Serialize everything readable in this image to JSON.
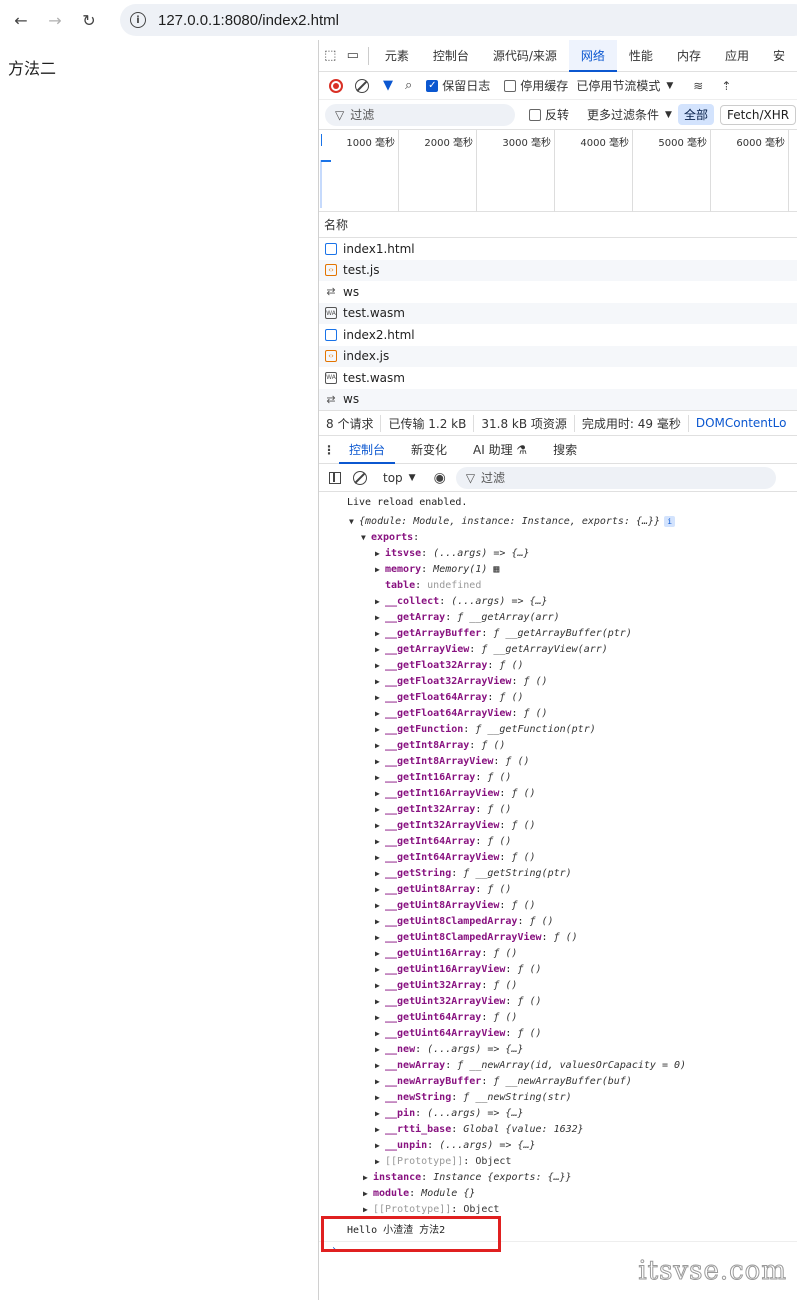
{
  "browser": {
    "url": "127.0.0.1:8080/index2.html"
  },
  "page": {
    "heading": "方法二"
  },
  "devtools": {
    "tabs": [
      "元素",
      "控制台",
      "源代码/来源",
      "网络",
      "性能",
      "内存",
      "应用",
      "安"
    ],
    "active_tab": "网络",
    "network_toolbar": {
      "preserve_log": "保留日志",
      "disable_cache": "停用缓存",
      "throttle": "已停用节流模式"
    },
    "filter_row": {
      "placeholder": "过滤",
      "invert": "反转",
      "more_filters": "更多过滤条件",
      "all": "全部",
      "fetch_xhr": "Fetch/XHR"
    },
    "timeline_ticks": [
      "1000 毫秒",
      "2000 毫秒",
      "3000 毫秒",
      "4000 毫秒",
      "5000 毫秒",
      "6000 毫秒"
    ],
    "requests_header": "名称",
    "requests": [
      {
        "name": "index1.html",
        "icon": "document-icon"
      },
      {
        "name": "test.js",
        "icon": "script-icon"
      },
      {
        "name": "ws",
        "icon": "websocket-icon"
      },
      {
        "name": "test.wasm",
        "icon": "wasm-icon"
      },
      {
        "name": "index2.html",
        "icon": "document-icon"
      },
      {
        "name": "index.js",
        "icon": "script-icon"
      },
      {
        "name": "test.wasm",
        "icon": "wasm-icon"
      },
      {
        "name": "ws",
        "icon": "websocket-icon"
      }
    ],
    "summary": {
      "requests": "8 个请求",
      "transferred": "已传输 1.2 kB",
      "resources": "31.8 kB 项资源",
      "finish": "完成用时: 49 毫秒",
      "dcl": "DOMContentLo"
    },
    "drawer_tabs": [
      "控制台",
      "新变化",
      "AI 助理 ⚗",
      "搜索"
    ],
    "console_toolbar": {
      "context": "top",
      "filter_placeholder": "过滤"
    },
    "console": {
      "live_reload": "Live reload enabled.",
      "object_summary_module": "module",
      "object_summary": {
        "module_key": "module",
        "module_val": "Module",
        "instance_key": "instance",
        "instance_val": "Instance",
        "exports_key": "exports",
        "exports_val": "{…}"
      },
      "exports_label": "exports",
      "exports": [
        {
          "key": "itsvse",
          "val": "(...args) => {…}",
          "expand": true
        },
        {
          "key": "memory",
          "val": "Memory(1) ▦",
          "expand": true
        },
        {
          "key": "table",
          "val": "undefined",
          "expand": false,
          "muted": true
        },
        {
          "key": "__collect",
          "val": "(...args) => {…}",
          "expand": true
        },
        {
          "key": "__getArray",
          "val": "ƒ __getArray(arr)",
          "expand": true
        },
        {
          "key": "__getArrayBuffer",
          "val": "ƒ __getArrayBuffer(ptr)",
          "expand": true
        },
        {
          "key": "__getArrayView",
          "val": "ƒ __getArrayView(arr)",
          "expand": true
        },
        {
          "key": "__getFloat32Array",
          "val": "ƒ ()",
          "expand": true
        },
        {
          "key": "__getFloat32ArrayView",
          "val": "ƒ ()",
          "expand": true
        },
        {
          "key": "__getFloat64Array",
          "val": "ƒ ()",
          "expand": true
        },
        {
          "key": "__getFloat64ArrayView",
          "val": "ƒ ()",
          "expand": true
        },
        {
          "key": "__getFunction",
          "val": "ƒ __getFunction(ptr)",
          "expand": true
        },
        {
          "key": "__getInt8Array",
          "val": "ƒ ()",
          "expand": true
        },
        {
          "key": "__getInt8ArrayView",
          "val": "ƒ ()",
          "expand": true
        },
        {
          "key": "__getInt16Array",
          "val": "ƒ ()",
          "expand": true
        },
        {
          "key": "__getInt16ArrayView",
          "val": "ƒ ()",
          "expand": true
        },
        {
          "key": "__getInt32Array",
          "val": "ƒ ()",
          "expand": true
        },
        {
          "key": "__getInt32ArrayView",
          "val": "ƒ ()",
          "expand": true
        },
        {
          "key": "__getInt64Array",
          "val": "ƒ ()",
          "expand": true
        },
        {
          "key": "__getInt64ArrayView",
          "val": "ƒ ()",
          "expand": true
        },
        {
          "key": "__getString",
          "val": "ƒ __getString(ptr)",
          "expand": true
        },
        {
          "key": "__getUint8Array",
          "val": "ƒ ()",
          "expand": true
        },
        {
          "key": "__getUint8ArrayView",
          "val": "ƒ ()",
          "expand": true
        },
        {
          "key": "__getUint8ClampedArray",
          "val": "ƒ ()",
          "expand": true
        },
        {
          "key": "__getUint8ClampedArrayView",
          "val": "ƒ ()",
          "expand": true
        },
        {
          "key": "__getUint16Array",
          "val": "ƒ ()",
          "expand": true
        },
        {
          "key": "__getUint16ArrayView",
          "val": "ƒ ()",
          "expand": true
        },
        {
          "key": "__getUint32Array",
          "val": "ƒ ()",
          "expand": true
        },
        {
          "key": "__getUint32ArrayView",
          "val": "ƒ ()",
          "expand": true
        },
        {
          "key": "__getUint64Array",
          "val": "ƒ ()",
          "expand": true
        },
        {
          "key": "__getUint64ArrayView",
          "val": "ƒ ()",
          "expand": true
        },
        {
          "key": "__new",
          "val": "(...args) => {…}",
          "expand": true
        },
        {
          "key": "__newArray",
          "val": "ƒ __newArray(id, valuesOrCapacity = 0)",
          "expand": true
        },
        {
          "key": "__newArrayBuffer",
          "val": "ƒ __newArrayBuffer(buf)",
          "expand": true
        },
        {
          "key": "__newString",
          "val": "ƒ __newString(str)",
          "expand": true
        },
        {
          "key": "__pin",
          "val": "(...args) => {…}",
          "expand": true
        },
        {
          "key": "__rtti_base",
          "val": "Global {value: 1632}",
          "expand": true
        },
        {
          "key": "__unpin",
          "val": "(...args) => {…}",
          "expand": true
        },
        {
          "key": "[[Prototype]]",
          "val": "Object",
          "expand": true,
          "proto": true
        }
      ],
      "tail": [
        {
          "key": "instance",
          "val": "Instance {exports: {…}}"
        },
        {
          "key": "module",
          "val": "Module {}"
        },
        {
          "key": "[[Prototype]]",
          "val": "Object",
          "proto": true
        }
      ],
      "output": "Hello 小渣渣 方法2",
      "prompt": "›"
    }
  },
  "watermark": "itsvse.com",
  "colors": {
    "accent": "#0b57d0",
    "highlight_border": "#e02020",
    "console_key": "#881280"
  }
}
